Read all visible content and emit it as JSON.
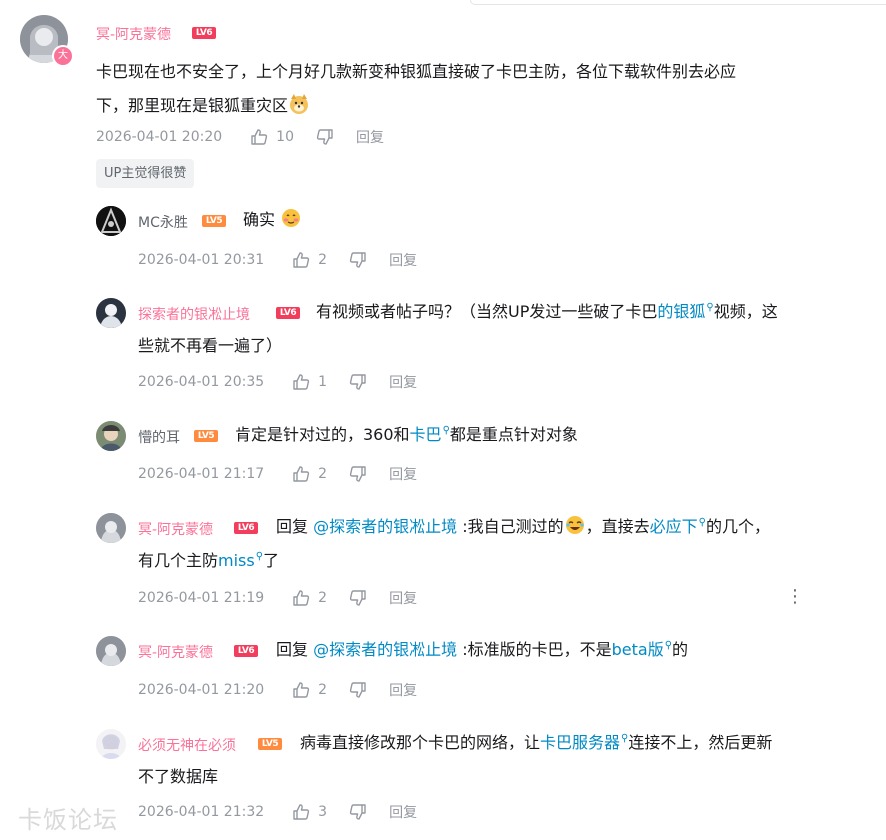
{
  "main_comment": {
    "user": "冥-阿克蒙德",
    "level": "LV6",
    "text_line1": "卡巴现在也不安全了，上个月好几款新变种银狐直接破了卡巴主防，各位下载软件别去必应",
    "text_line2": "下，那里现在是银狐重灾区",
    "time": "2026-04-01 20:20",
    "likes": "10",
    "reply_label": "回复",
    "tag": "UP主觉得很赞"
  },
  "replies": [
    {
      "user": "MC永胜",
      "level": "LV5",
      "text": "确实",
      "time": "2026-04-01 20:31",
      "likes": "2",
      "reply_label": "回复"
    },
    {
      "user": "探索者的银凇止境",
      "level": "LV6",
      "text_a": "有视频或者帖子吗？（当然UP发过一些破了卡巴",
      "link": "的银狐",
      "text_b": "视频，这",
      "text_line2": "些就不再看一遍了）",
      "time": "2026-04-01 20:35",
      "likes": "1",
      "reply_label": "回复"
    },
    {
      "user": "懵的耳",
      "level": "LV5",
      "text_a": "肯定是针对过的，360和",
      "link": "卡巴",
      "text_b": "都是重点针对对象",
      "time": "2026-04-01 21:17",
      "likes": "2",
      "reply_label": "回复"
    },
    {
      "user": "冥-阿克蒙德",
      "level": "LV6",
      "reply_prefix": "回复",
      "mention": "@探索者的银凇止境",
      "text_a": ":我自己测过的",
      "text_b": "，直接去",
      "link": "必应下",
      "text_c": "的几个，",
      "line2_a": "有几个主防",
      "line2_link": "miss",
      "line2_b": "了",
      "time": "2026-04-01 21:19",
      "likes": "2",
      "reply_label": "回复"
    },
    {
      "user": "冥-阿克蒙德",
      "level": "LV6",
      "reply_prefix": "回复",
      "mention": "@探索者的银凇止境",
      "text_a": ":标准版的卡巴，不是",
      "link": "beta版",
      "text_b": "的",
      "time": "2026-04-01 21:20",
      "likes": "2",
      "reply_label": "回复"
    },
    {
      "user": "必须无神在必须",
      "level": "LV5",
      "text_a": "病毒直接修改那个卡巴的网络，让",
      "link": "卡巴服务器",
      "text_b": "连接不上，然后更新",
      "text_line2": "不了数据库",
      "time": "2026-04-01 21:32",
      "likes": "3",
      "reply_label": "回复"
    }
  ],
  "watermark": "卡饭论坛",
  "colors": {
    "name_pink": "#fb7299",
    "link_blue": "#008ac5",
    "meta_gray": "#9499a0"
  }
}
